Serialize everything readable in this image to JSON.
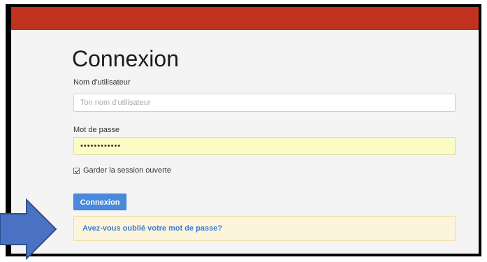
{
  "header": {
    "bar_color": "#c0321e"
  },
  "login": {
    "title": "Connexion",
    "username_label": "Nom d'utilisateur",
    "username_placeholder": "Ton nom d'utilisateur",
    "username_value": "",
    "password_label": "Mot de passe",
    "password_value": "••••••••••••",
    "remember_label": "Garder la session ouverte",
    "remember_checked": true,
    "submit_label": "Connexion",
    "forgot_label": "Avez-vous oublié votre mot de passe?"
  },
  "colors": {
    "button": "#4a89dc",
    "link": "#3a7bd5",
    "notice_bg": "#fcf5dc",
    "autofill_bg": "#fbfbc6"
  },
  "annotation": {
    "icon": "arrow-right-icon",
    "color": "#4a72c4"
  }
}
